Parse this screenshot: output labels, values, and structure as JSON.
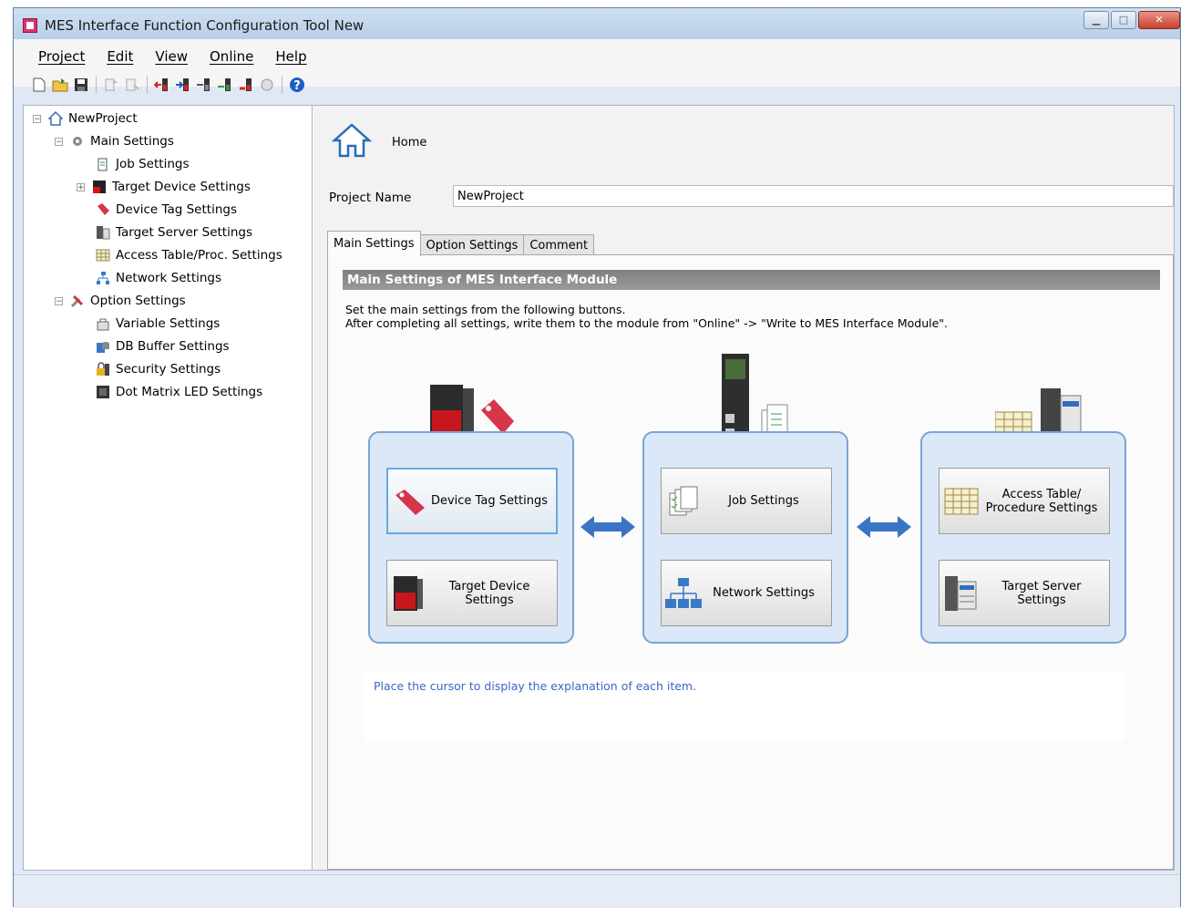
{
  "window": {
    "title": "MES Interface Function Configuration Tool New",
    "buttons": {
      "minimize": "▁",
      "maximize": "□",
      "close": "✕"
    }
  },
  "menu": [
    "Project",
    "Edit",
    "View",
    "Online",
    "Help"
  ],
  "toolbar": {
    "icons": [
      "new-file-icon",
      "open-folder-icon",
      "save-icon",
      "export-icon",
      "import-icon",
      "read-from-module-icon",
      "write-to-module-icon",
      "verify-icon",
      "upload-icon",
      "download-icon",
      "tools-icon",
      "help-icon"
    ]
  },
  "tree": {
    "root": "NewProject",
    "main_settings": "Main Settings",
    "main_children": [
      "Job Settings",
      "Target Device Settings",
      "Device Tag Settings",
      "Target Server Settings",
      "Access Table/Proc. Settings",
      "Network Settings"
    ],
    "option_settings": "Option Settings",
    "option_children": [
      "Variable Settings",
      "DB Buffer Settings",
      "Security Settings",
      "Dot Matrix LED Settings"
    ]
  },
  "home": {
    "label": "Home"
  },
  "project": {
    "name_label": "Project Name",
    "name_value": "NewProject"
  },
  "tabs": [
    "Main Settings",
    "Option Settings",
    "Comment"
  ],
  "main_panel": {
    "header": "Main Settings of MES Interface Module",
    "intro_line1": "Set the main settings from the following buttons.",
    "intro_line2": "After completing all settings, write them to the module from \"Online\" -> \"Write to MES Interface Module\".",
    "buttons": {
      "device_tag": "Device Tag Settings",
      "target_device": "Target Device Settings",
      "job": "Job Settings",
      "network": "Network Settings",
      "access_table": "Access Table/ Procedure Settings",
      "target_server": "Target Server Settings"
    },
    "explanation": "Place the cursor to display the explanation of each item."
  },
  "colors": {
    "accent": "#7aa4d4",
    "group_fill": "#dae8f8",
    "explain_text": "#3a66c8",
    "header_bar": "#8c8c8c"
  }
}
